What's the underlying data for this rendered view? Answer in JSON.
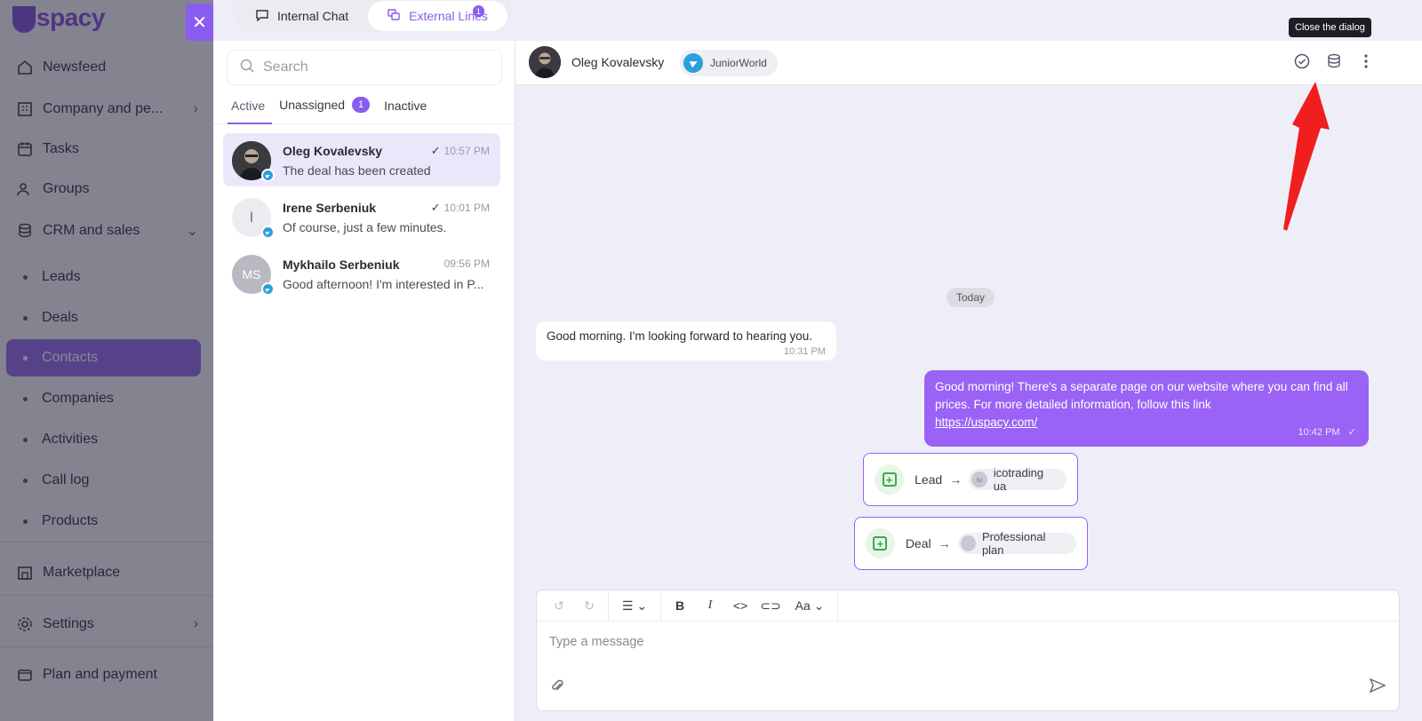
{
  "app": {
    "logo": "spacy"
  },
  "sidebar": {
    "items": [
      {
        "label": "Newsfeed",
        "icon": "home-icon"
      },
      {
        "label": "Company and pe...",
        "icon": "building-icon"
      },
      {
        "label": "Tasks",
        "icon": "calendar-icon"
      },
      {
        "label": "Groups",
        "icon": "users-icon"
      },
      {
        "label": "CRM and sales",
        "icon": "database-icon"
      },
      {
        "label": "Marketplace",
        "icon": "store-icon"
      },
      {
        "label": "Settings",
        "icon": "gear-icon"
      },
      {
        "label": "Plan and payment",
        "icon": "wallet-icon"
      }
    ],
    "crm_sub": [
      "Leads",
      "Deals",
      "Contacts",
      "Companies",
      "Activities",
      "Call log",
      "Products"
    ],
    "active_sub": "Contacts"
  },
  "close_button": {
    "label": "✕"
  },
  "top_tabs": [
    {
      "label": "Internal Chat",
      "icon": "chat-bubble-icon"
    },
    {
      "label": "External Lines",
      "icon": "chat-external-icon",
      "badge": "1"
    }
  ],
  "search": {
    "placeholder": "Search"
  },
  "list_tabs": [
    {
      "label": "Active"
    },
    {
      "label": "Unassigned",
      "count": "1"
    },
    {
      "label": "Inactive"
    }
  ],
  "conversations": [
    {
      "name": "Oleg Kovalevsky",
      "time": "10:57 PM",
      "preview": "The deal has been created",
      "read": true,
      "avatar_initials": ""
    },
    {
      "name": "Irene Serbeniuk",
      "time": "10:01 PM",
      "preview": "Of course, just a few minutes.",
      "read": true,
      "avatar_initials": "I"
    },
    {
      "name": "Mykhailo Serbeniuk",
      "time": "09:56 PM",
      "preview": "Good afternoon! I'm interested in P...",
      "read": false,
      "avatar_initials": "MS"
    }
  ],
  "chat_header": {
    "name": "Oleg Kovalevsky",
    "channel": "JuniorWorld",
    "tooltip": "Close the dialog"
  },
  "messages": {
    "date": "Today",
    "incoming": {
      "text": "Good morning. I'm looking forward to hearing you.",
      "time": "10:31 PM"
    },
    "outgoing": {
      "text": "Good morning! There's a separate page on our website where you can find all prices. For more detailed information, follow this link",
      "link": "https://uspacy.com/",
      "time": "10:42 PM"
    }
  },
  "crm_events": [
    {
      "type": "Lead",
      "target": "icotrading ua",
      "target_initials": "iu"
    },
    {
      "type": "Deal",
      "target": "Professional plan",
      "target_initials": ""
    }
  ],
  "composer": {
    "placeholder": "Type a message",
    "font_label": "Aa"
  },
  "colors": {
    "accent": "#8a5cf0",
    "outgoing_bubble": "#9a62f5",
    "annotation": "#f01e1e"
  }
}
